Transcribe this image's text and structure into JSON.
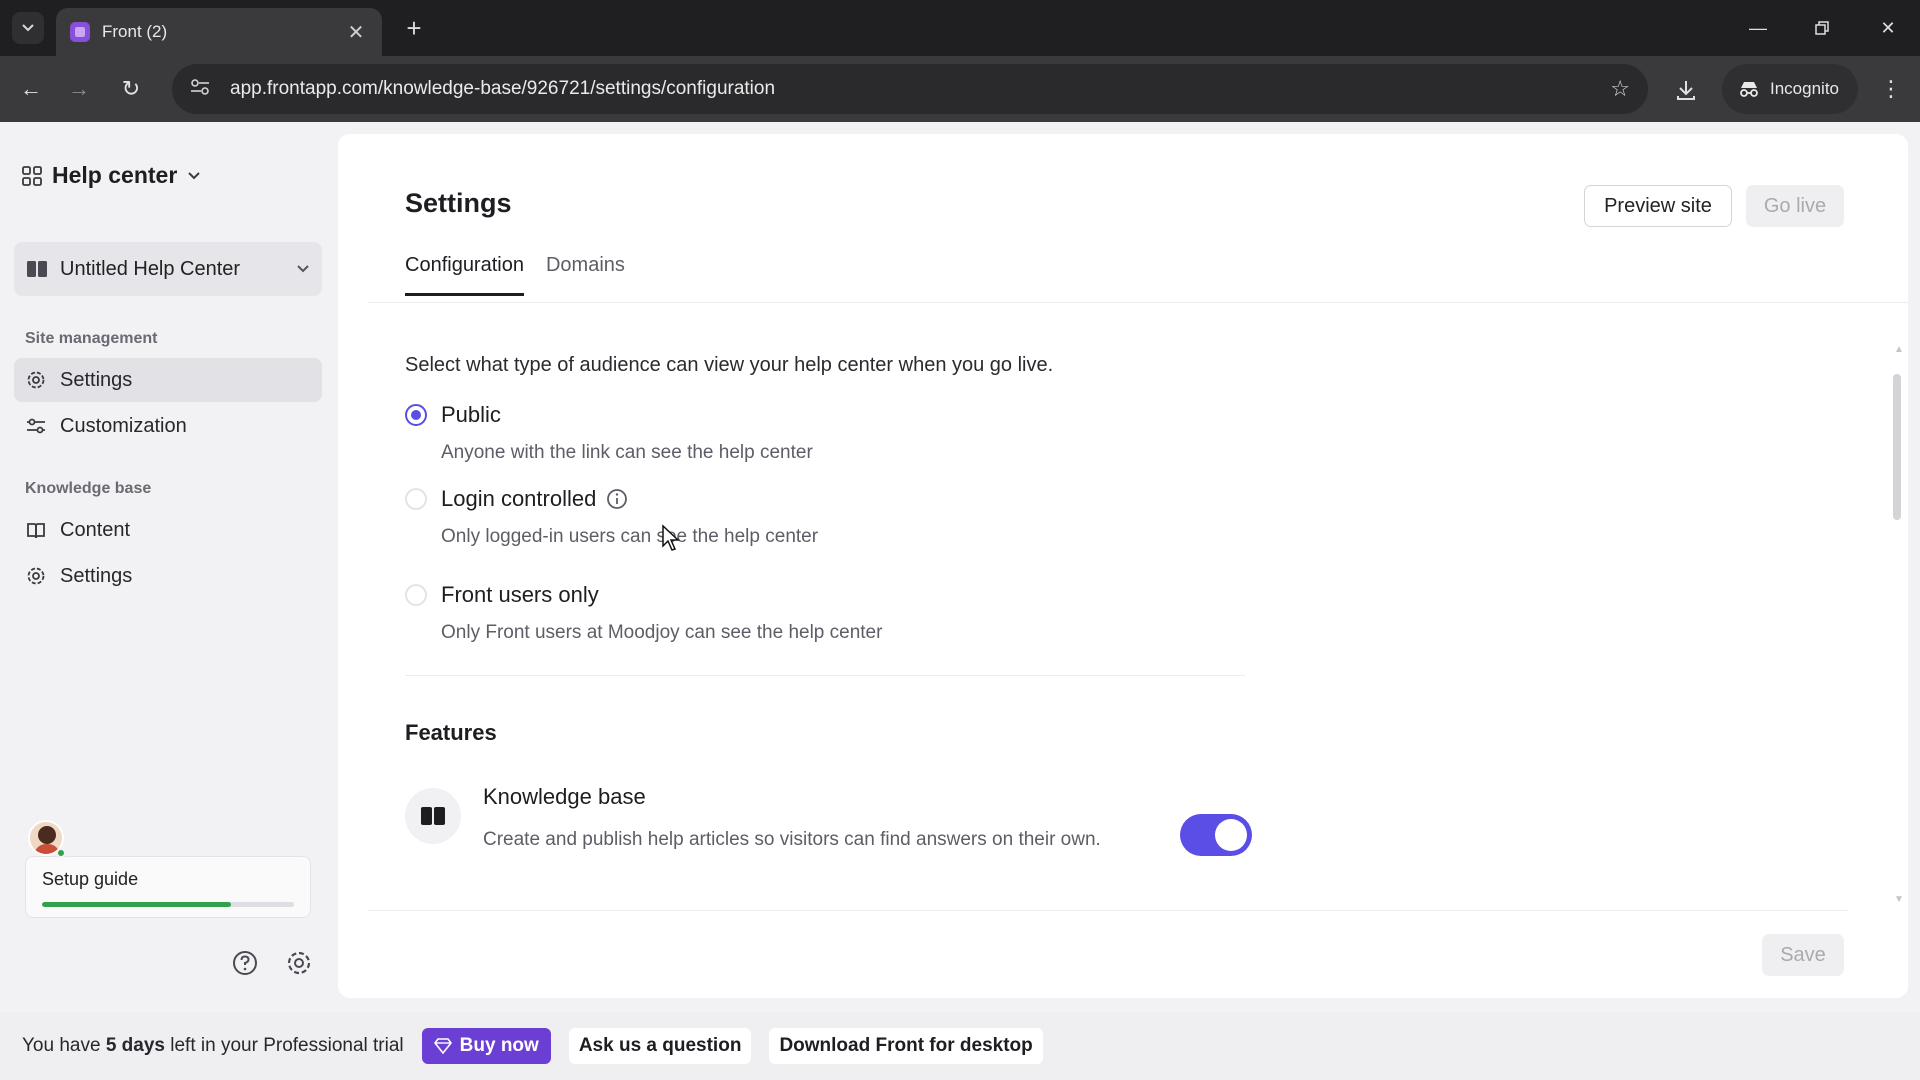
{
  "browser": {
    "tab_title": "Front (2)",
    "url": "app.frontapp.com/knowledge-base/926721/settings/configuration",
    "incognito_label": "Incognito"
  },
  "sidebar": {
    "workspace_title": "Help center",
    "help_center_name": "Untitled Help Center",
    "sections": [
      {
        "title": "Site management",
        "items": [
          {
            "label": "Settings",
            "icon": "gear-icon",
            "active": true
          },
          {
            "label": "Customization",
            "icon": "sliders-icon"
          }
        ]
      },
      {
        "title": "Knowledge base",
        "items": [
          {
            "label": "Content",
            "icon": "book-icon"
          },
          {
            "label": "Settings",
            "icon": "gear-icon"
          }
        ]
      }
    ],
    "setup_guide": {
      "label": "Setup guide",
      "progress": 0.75
    }
  },
  "main": {
    "title": "Settings",
    "preview_label": "Preview site",
    "golive_label": "Go live",
    "tabs": [
      {
        "label": "Configuration",
        "active": true
      },
      {
        "label": "Domains"
      }
    ],
    "audience_intro": "Select what type of audience can view your help center when you go live.",
    "audience_options": [
      {
        "title": "Public",
        "desc": "Anyone with the link can see the help center",
        "checked": true
      },
      {
        "title": "Login controlled",
        "desc": "Only logged-in users can see the help center",
        "info_icon": true
      },
      {
        "title": "Front users only",
        "desc": "Only Front users at Moodjoy can see the help center"
      }
    ],
    "features_title": "Features",
    "feature": {
      "title": "Knowledge base",
      "desc": "Create and publish help articles so visitors can find answers on their own.",
      "enabled": true
    },
    "save_label": "Save"
  },
  "trial_bar": {
    "prefix": "You have ",
    "days": "5 days",
    "suffix": " left in your Professional trial",
    "buy_label": "Buy now",
    "ask_label": "Ask us a question",
    "download_label": "Download Front for desktop"
  },
  "colors": {
    "accent": "#5b4ee6",
    "buy": "#6c3fd4",
    "progress": "#31a24c"
  }
}
